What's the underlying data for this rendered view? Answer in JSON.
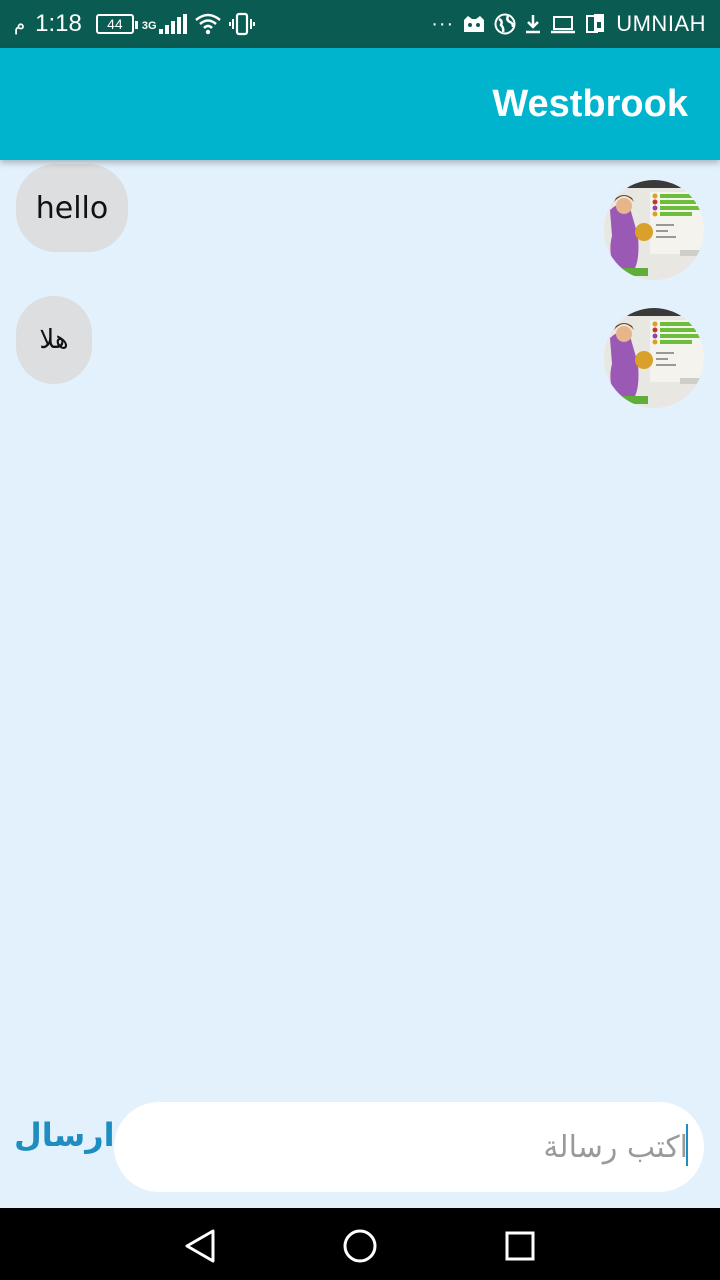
{
  "status_bar": {
    "time": "1:18",
    "period": "م",
    "battery": "44",
    "network": "3G",
    "dots": "···",
    "carrier": "UMNIAH"
  },
  "app_bar": {
    "title": "Westbrook"
  },
  "messages": [
    {
      "text": "hello",
      "avatar": "character-avatar"
    },
    {
      "text": "هلا",
      "avatar": "character-avatar"
    }
  ],
  "composer": {
    "send_label": "ارسال",
    "placeholder": "اكتب رسالة",
    "value": ""
  },
  "colors": {
    "status_bar": "#0A5B52",
    "app_bar": "#00B4CE",
    "background": "#E3F1FD",
    "bubble": "#DCDEDF",
    "send": "#1E8DC0"
  },
  "nav_bar": {
    "icons": [
      "back-icon",
      "home-icon",
      "recents-icon"
    ]
  }
}
